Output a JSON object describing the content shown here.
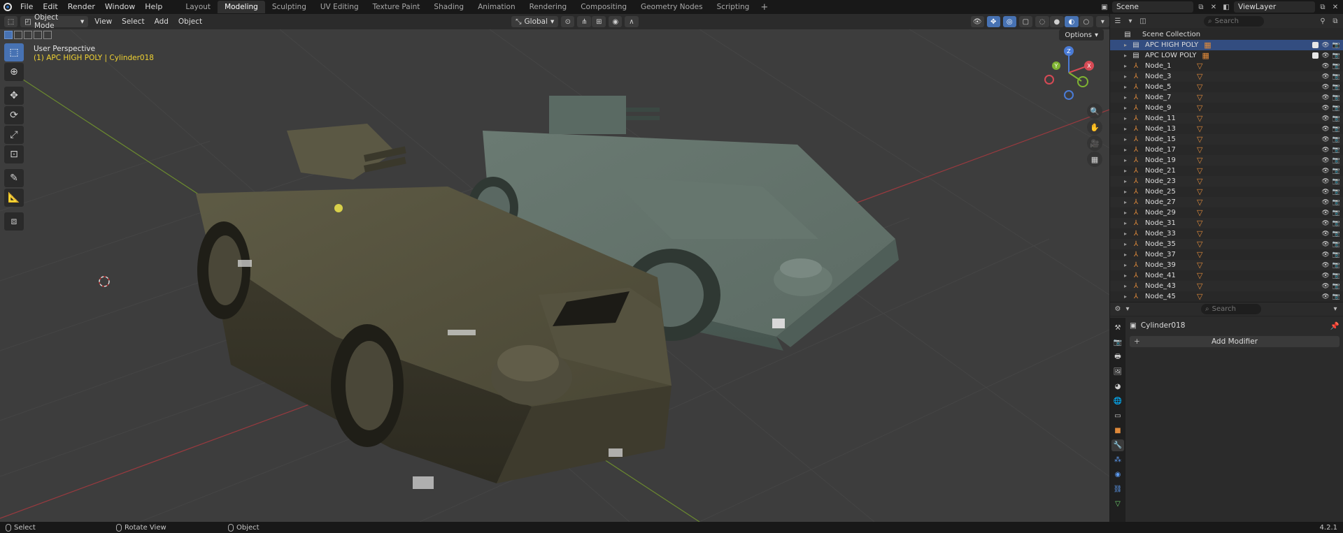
{
  "menu": {
    "items": [
      "File",
      "Edit",
      "Render",
      "Window",
      "Help"
    ]
  },
  "workspaces": {
    "tabs": [
      "Layout",
      "Modeling",
      "Sculpting",
      "UV Editing",
      "Texture Paint",
      "Shading",
      "Animation",
      "Rendering",
      "Compositing",
      "Geometry Nodes",
      "Scripting"
    ],
    "active": "Modeling"
  },
  "top_right": {
    "scene": "Scene",
    "view_layer": "ViewLayer"
  },
  "viewport": {
    "mode": "Object Mode",
    "menus": [
      "View",
      "Select",
      "Add",
      "Object"
    ],
    "orientation": "Global",
    "options_label": "Options",
    "perspective_label": "User Perspective",
    "active_object_label": "(1) APC HIGH POLY | Cylinder018",
    "gizmo": {
      "z": "Z",
      "y": "Y",
      "x": "X"
    }
  },
  "outliner": {
    "search_placeholder": "Search",
    "root": "Scene Collection",
    "collections": [
      {
        "name": "APC HIGH POLY",
        "selected": true
      },
      {
        "name": "APC LOW POLY",
        "selected": false
      }
    ],
    "nodes": [
      "Node_1",
      "Node_3",
      "Node_5",
      "Node_7",
      "Node_9",
      "Node_11",
      "Node_13",
      "Node_15",
      "Node_17",
      "Node_19",
      "Node_21",
      "Node_23",
      "Node_25",
      "Node_27",
      "Node_29",
      "Node_31",
      "Node_33",
      "Node_35",
      "Node_37",
      "Node_39",
      "Node_41",
      "Node_43",
      "Node_45"
    ]
  },
  "properties": {
    "search_placeholder": "Search",
    "object_name": "Cylinder018",
    "add_modifier_label": "Add Modifier"
  },
  "statusbar": {
    "select": "Select",
    "rotate": "Rotate View",
    "object": "Object",
    "version": "4.2.1"
  },
  "colors": {
    "accent": "#4772b3",
    "active_text": "#f0d232",
    "viewport_bg": "#3d3d3d"
  }
}
